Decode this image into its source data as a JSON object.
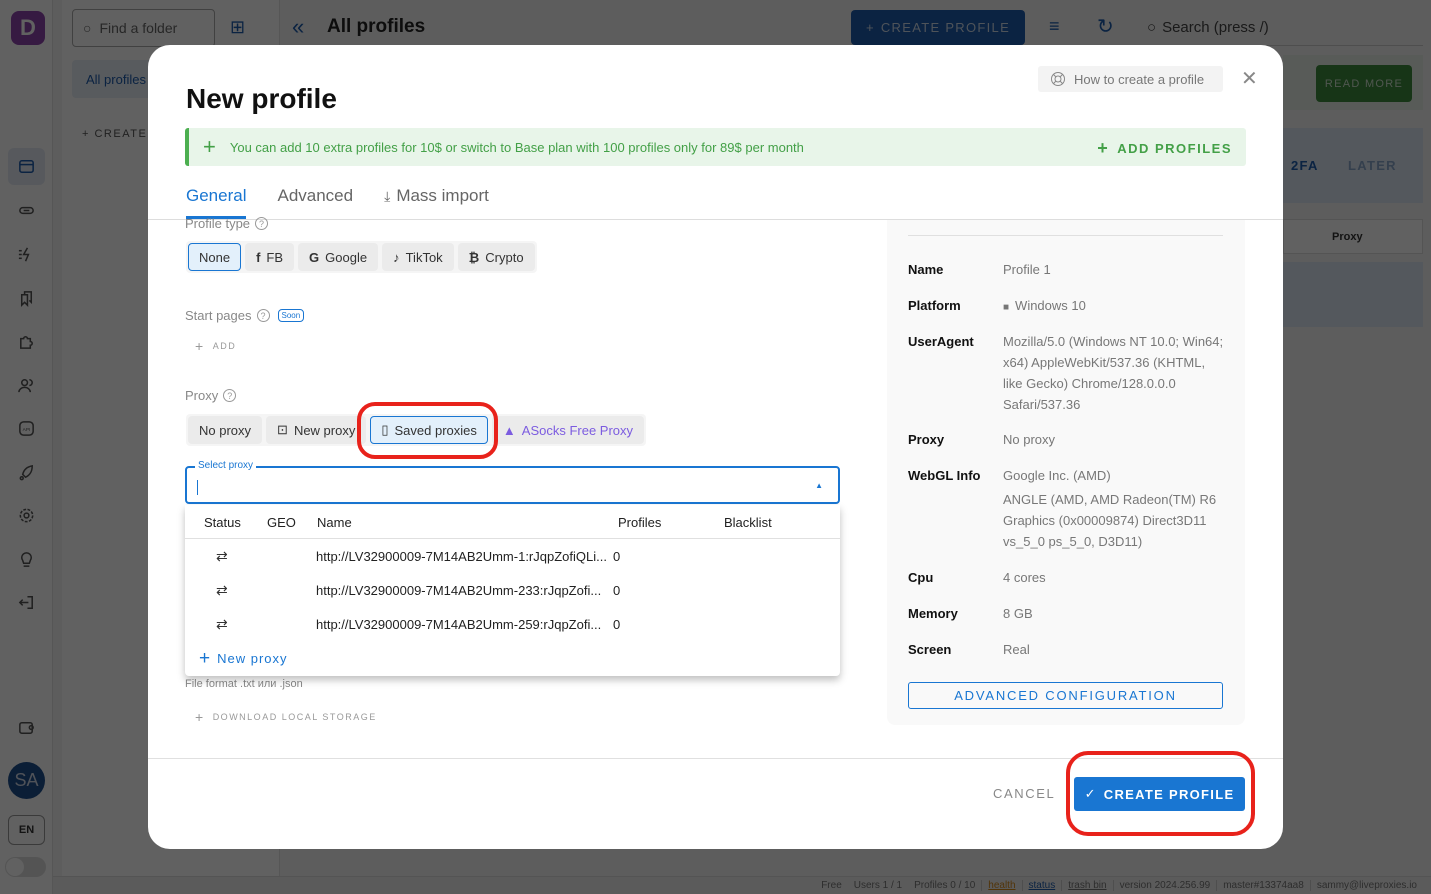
{
  "app": {
    "logo_letter": "D",
    "sidebar_icons": [
      "browser-icon",
      "link-icon",
      "automation-icon",
      "bookmarks-icon",
      "extensions-icon",
      "users-icon",
      "api-icon",
      "rocket-icon",
      "settings-icon",
      "lightbulb-icon",
      "logout-icon",
      "wallet-icon"
    ],
    "avatar_initials": "SA",
    "language": "EN"
  },
  "folders": {
    "search_placeholder": "Find a folder",
    "all_profiles": "All profiles",
    "create_label": "CREATE"
  },
  "topbar": {
    "title": "All profiles",
    "create_profile": "CREATE PROFILE",
    "search_placeholder": "Search (press /)"
  },
  "background": {
    "read_more": "READ MORE",
    "twofa": "2FA",
    "later": "LATER",
    "proxy_column": "Proxy"
  },
  "statusbar": {
    "plan": "Free",
    "users": "Users 1 / 1",
    "profiles": "Profiles 0 / 10",
    "health": "health",
    "status": "status",
    "trash": "trash bin",
    "version": "version 2024.256.99",
    "branch": "master#13374aa8",
    "email": "sammy@liveproxies.io"
  },
  "modal": {
    "title": "New profile",
    "how_to": "How to create a profile",
    "promo": {
      "text": "You can add 10 extra profiles for 10$ or switch to Base plan with 100 profiles only for 89$ per month",
      "action": "ADD PROFILES"
    },
    "tabs": [
      {
        "label": "General",
        "active": true
      },
      {
        "label": "Advanced",
        "active": false
      },
      {
        "label": "Mass import",
        "active": false
      }
    ],
    "profile_type": {
      "label": "Profile type",
      "options": [
        "None",
        "FB",
        "Google",
        "TikTok",
        "Crypto"
      ],
      "selected": "None"
    },
    "start_pages": {
      "label": "Start pages",
      "badge": "Soon",
      "add": "ADD"
    },
    "proxy": {
      "label": "Proxy",
      "options": [
        "No proxy",
        "New proxy",
        "Saved proxies",
        "ASocks Free Proxy"
      ],
      "selected": "Saved proxies",
      "select_label": "Select proxy",
      "select_value": "",
      "table": {
        "headers": [
          "Status",
          "GEO",
          "Name",
          "Profiles",
          "Blacklist"
        ],
        "rows": [
          {
            "status": "⇄",
            "geo": "",
            "name": "http://LV32900009-7M14AB2Umm-1:rJqpZofiQLi...",
            "profiles": "0",
            "blacklist": ""
          },
          {
            "status": "⇄",
            "geo": "",
            "name": "http://LV32900009-7M14AB2Umm-233:rJqpZofi...",
            "profiles": "0",
            "blacklist": ""
          },
          {
            "status": "⇄",
            "geo": "",
            "name": "http://LV32900009-7M14AB2Umm-259:rJqpZofi...",
            "profiles": "0",
            "blacklist": ""
          }
        ]
      },
      "new_proxy": "New proxy"
    },
    "file_format": "File format .txt или .json",
    "download_local_storage": "DOWNLOAD LOCAL STORAGE",
    "summary": [
      {
        "key": "Name",
        "value": "Profile 1"
      },
      {
        "key": "Platform",
        "value": "Windows 10"
      },
      {
        "key": "UserAgent",
        "value": "Mozilla/5.0 (Windows NT 10.0; Win64; x64) AppleWebKit/537.36 (KHTML, like Gecko) Chrome/128.0.0.0 Safari/537.36"
      },
      {
        "key": "Proxy",
        "value": "No proxy"
      },
      {
        "key": "WebGL Info",
        "value": "Google Inc. (AMD)",
        "value2": "ANGLE (AMD, AMD Radeon(TM) R6 Graphics (0x00009874) Direct3D11 vs_5_0 ps_5_0, D3D11)"
      },
      {
        "key": "Cpu",
        "value": "4 cores"
      },
      {
        "key": "Memory",
        "value": "8 GB"
      },
      {
        "key": "Screen",
        "value": "Real"
      }
    ],
    "advanced_config": "ADVANCED CONFIGURATION",
    "cancel": "CANCEL",
    "create": "CREATE PROFILE"
  },
  "colors": {
    "primary": "#1976d2",
    "promo_green": "#43a047",
    "highlight_red": "#e8221b",
    "asocks_purple": "#7c5ce0"
  }
}
